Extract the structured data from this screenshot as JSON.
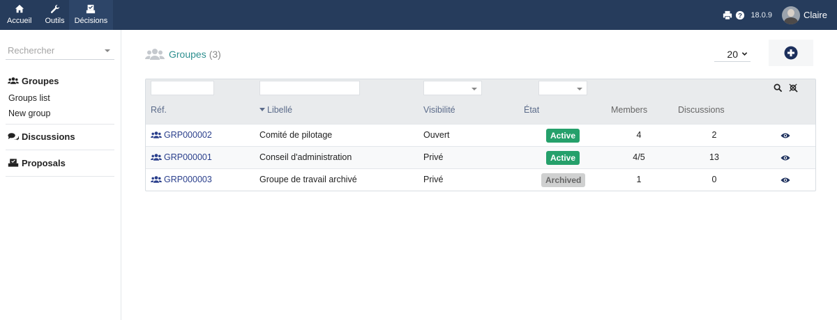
{
  "topnav": {
    "items": [
      {
        "label": "Accueil",
        "icon": "home-icon"
      },
      {
        "label": "Outils",
        "icon": "wrench-icon"
      },
      {
        "label": "Décisions",
        "icon": "ballot-box-icon"
      }
    ],
    "version": "18.0.9",
    "user_name": "Claire"
  },
  "sidebar": {
    "search_placeholder": "Rechercher",
    "sections": [
      {
        "title": "Groupes",
        "icon": "users-icon",
        "links": [
          "Groups list",
          "New group"
        ]
      },
      {
        "title": "Discussions",
        "icon": "comments-icon",
        "links": []
      },
      {
        "title": "Proposals",
        "icon": "ballot-box-icon",
        "links": []
      }
    ]
  },
  "main": {
    "title": "Groupes",
    "count": "(3)",
    "per_page": "20",
    "columns": [
      "Réf.",
      "Libellé",
      "Visibilité",
      "État",
      "Members",
      "Discussions"
    ],
    "rows": [
      {
        "ref": "GRP000002",
        "label": "Comité de pilotage",
        "visibility": "Ouvert",
        "state": "Active",
        "members": "4",
        "discussions": "2"
      },
      {
        "ref": "GRP000001",
        "label": "Conseil d'administration",
        "visibility": "Privé",
        "state": "Active",
        "members": "4/5",
        "discussions": "13"
      },
      {
        "ref": "GRP000003",
        "label": "Groupe de travail archivé",
        "visibility": "Privé",
        "state": "Archived",
        "members": "1",
        "discussions": "0"
      }
    ]
  },
  "colors": {
    "topbar": "#263c5c",
    "accent_teal": "#2d8f8f",
    "link": "#2a3f8c",
    "badge_active": "#25a06b",
    "badge_archived": "#cfd0d0"
  }
}
